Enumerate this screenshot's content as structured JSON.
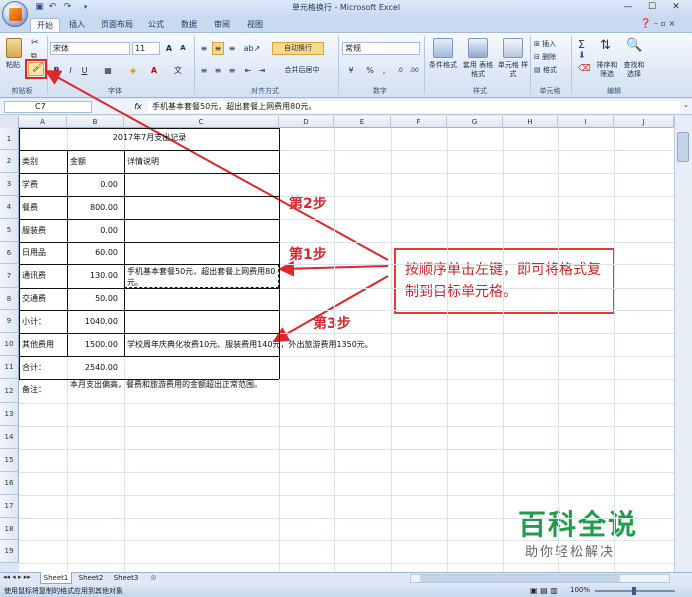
{
  "window": {
    "title": "单元格换行 - Microsoft Excel"
  },
  "tabs": [
    "开始",
    "插入",
    "页面布局",
    "公式",
    "数据",
    "审阅",
    "视图"
  ],
  "ribbon": {
    "clipboard": {
      "paste": "粘贴",
      "group": "剪贴板"
    },
    "font": {
      "name": "宋体",
      "size": "11",
      "group": "字体",
      "bold": "B",
      "italic": "I",
      "underline": "U",
      "grow": "A",
      "shrink": "A"
    },
    "align": {
      "wrap": "自动换行",
      "merge": "合并后居中",
      "group": "对齐方式"
    },
    "number": {
      "format": "常规",
      "percent": "%",
      "comma": ",",
      "group": "数字"
    },
    "styles": {
      "cond": "条件格式",
      "table": "套用 表格格式",
      "cell": "单元格 样式",
      "group": "样式"
    },
    "cells": {
      "insert": "插入",
      "delete": "删除",
      "format": "格式",
      "group": "单元格"
    },
    "editing": {
      "sort": "排序和 筛选",
      "find": "查找和 选择",
      "group": "编辑"
    }
  },
  "formula_bar": {
    "name_box": "C7",
    "fx": "fx",
    "content": "手机基本套餐50元，超出套餐上网费用80元。"
  },
  "columns": [
    "A",
    "B",
    "C",
    "D",
    "E",
    "F",
    "G",
    "H",
    "I",
    "J"
  ],
  "rows": [
    "1",
    "2",
    "3",
    "4",
    "5",
    "6",
    "7",
    "8",
    "9",
    "10",
    "11",
    "12",
    "13",
    "14",
    "15",
    "16",
    "17",
    "18",
    "19"
  ],
  "sheet": {
    "title": "2017年7月支出记录",
    "headers": [
      "类别",
      "金额",
      "详情说明"
    ],
    "data": [
      [
        "学费",
        "0.00",
        ""
      ],
      [
        "餐费",
        "800.00",
        ""
      ],
      [
        "服装费",
        "0.00",
        ""
      ],
      [
        "日用品",
        "60.00",
        ""
      ],
      [
        "通讯费",
        "130.00",
        "手机基本套餐50元，超出套餐上网费用80元。"
      ],
      [
        "交通费",
        "50.00",
        ""
      ],
      [
        "小计：",
        "1040.00",
        ""
      ],
      [
        "其他费用",
        "1500.00",
        "学校周年庆典化妆费10元、服装费用140元，外出旅游费用1350元。"
      ],
      [
        "合计：",
        "2540.00",
        ""
      ],
      [
        "备注：",
        "本月支出偏高，餐费和旅游费用的金额超出正常范围。",
        ""
      ]
    ]
  },
  "sheet_tabs": [
    "Sheet1",
    "Sheet2",
    "Sheet3"
  ],
  "status": {
    "message": "使用鼠标将复制的格式应用到其他对象",
    "zoom": "100%"
  },
  "annotations": {
    "step1": "第1步",
    "step2": "第2步",
    "step3": "第3步",
    "callout": "按顺序单击左键，即可将格式复制到目标单元格。",
    "color": "#d8262f"
  },
  "watermark": {
    "brand": "百科全说",
    "slogan": "助你轻松解决"
  }
}
